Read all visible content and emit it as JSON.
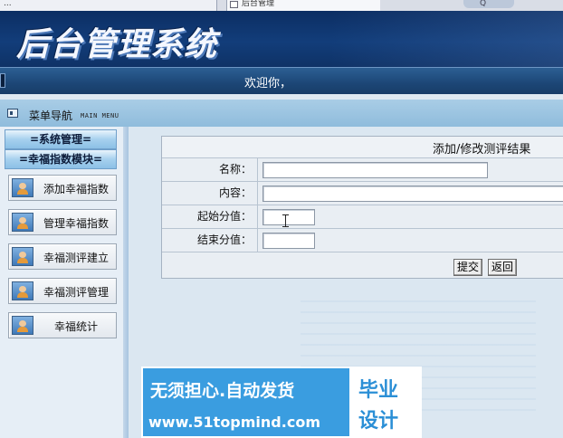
{
  "browser": {
    "tab1_label": "...",
    "tab2_label": "后台管理",
    "search_glyph": "Q"
  },
  "header": {
    "title": "后台管理系统",
    "welcome": "欢迎你，"
  },
  "menu": {
    "label": "菜单导航",
    "sub_label": "MAIN MENU"
  },
  "sidebar": {
    "sections": [
      "=系统管理=",
      "=幸福指数模块="
    ],
    "items": [
      {
        "label": "添加幸福指数"
      },
      {
        "label": "管理幸福指数"
      },
      {
        "label": "幸福测评建立"
      },
      {
        "label": "幸福测评管理"
      },
      {
        "label": "幸福统计"
      }
    ]
  },
  "form": {
    "title": "添加/修改测评结果",
    "fields": [
      {
        "label": "名称：",
        "value": ""
      },
      {
        "label": "内容：",
        "value": ""
      },
      {
        "label": "起始分值：",
        "value": ""
      },
      {
        "label": "结束分值：",
        "value": ""
      }
    ],
    "submit": "提交",
    "back": "返回"
  },
  "ad": {
    "line1": "无须担心.自动发货",
    "line2": "www.51topmind.com",
    "badge_line1": "毕业",
    "badge_line2": "设计"
  }
}
